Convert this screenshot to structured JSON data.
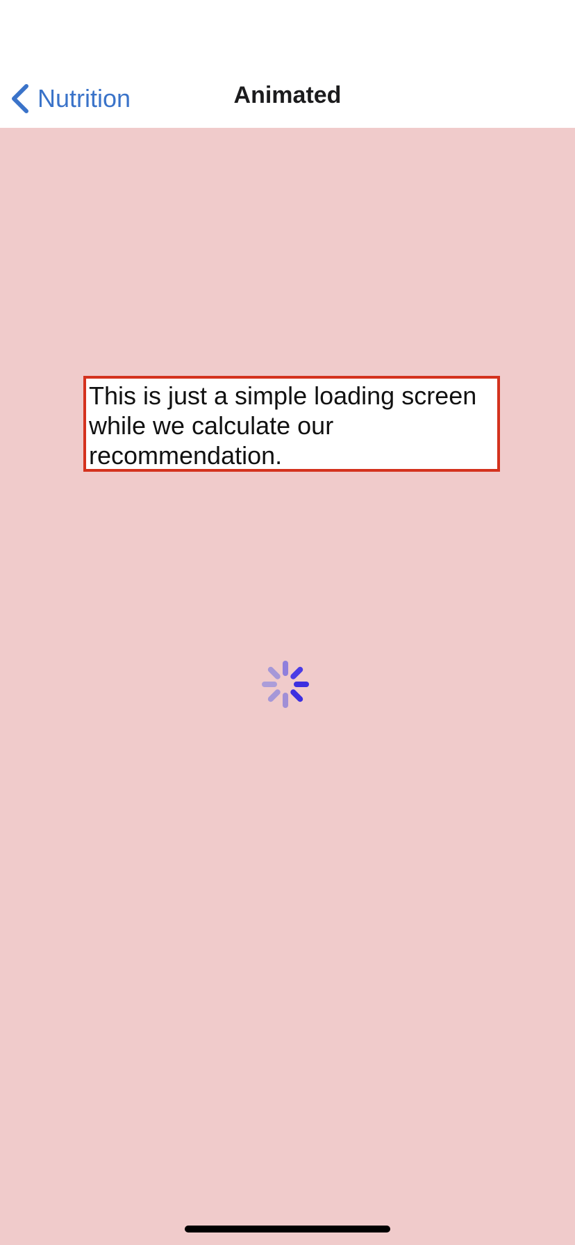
{
  "nav": {
    "back_label": "Nutrition",
    "title": "Animated"
  },
  "content": {
    "message": "This is just a simple loading screen while we calculate our recommendation."
  },
  "icons": {
    "back": "chevron-left-icon",
    "spinner": "loading-spinner-icon"
  },
  "colors": {
    "nav_background": "#ffffff",
    "content_background": "#f0cbcb",
    "accent": "#3a73c9",
    "box_border": "#d4321e",
    "spinner": "#3c2fe0"
  }
}
